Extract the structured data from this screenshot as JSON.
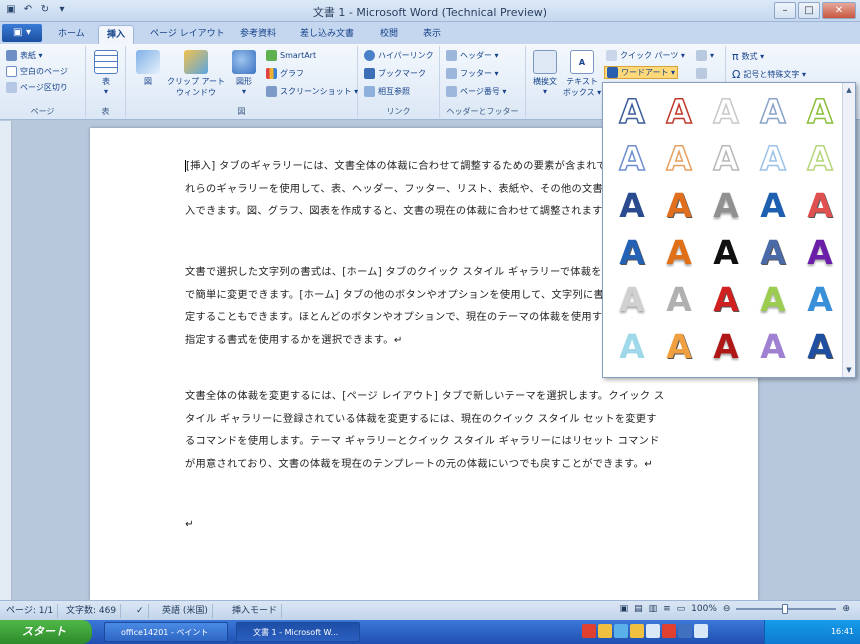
{
  "window": {
    "title": "文書 1 - Microsoft Word (Technical Preview)",
    "qat": [
      "save-icon",
      "undo-icon",
      "redo-icon"
    ]
  },
  "tabs": [
    "ホーム",
    "挿入",
    "ページ レイアウト",
    "参考資料",
    "差し込み文書",
    "校閲",
    "表示"
  ],
  "active_tab": "挿入",
  "ribbon": {
    "pages_group": {
      "label": "ページ",
      "items": [
        "表紙 ▾",
        "空白のページ",
        "ページ区切り"
      ]
    },
    "table_group": {
      "label": "表",
      "button": "表"
    },
    "illustrations_group": {
      "label": "図",
      "big": [
        "図",
        "クリップ アート",
        "図形"
      ],
      "clipart_sub": "ウィンドウ",
      "small": [
        "SmartArt",
        "グラフ",
        "スクリーンショット ▾"
      ]
    },
    "links_group": {
      "label": "リンク",
      "items": [
        "ハイパーリンク",
        "ブックマーク",
        "相互参照"
      ]
    },
    "headerfooter_group": {
      "label": "ヘッダーとフッター",
      "items": [
        "ヘッダー ▾",
        "フッター ▾",
        "ページ番号 ▾"
      ]
    },
    "text_group": {
      "big": [
        "横挨文",
        "テキスト"
      ],
      "textbox_sub": "ボックス ▾",
      "small": [
        "クイック パーツ ▾",
        "ワードアート ▾"
      ]
    },
    "symbols_group": {
      "items": [
        "数式 ▾",
        "記号と特殊文字 ▾"
      ]
    }
  },
  "document": {
    "paragraphs": [
      "[挿入] タブのギャラリーには、文書全体の体裁に合わせて調整するための要素が含まれています。これらのギャラリーを使用して、表、ヘッダー、フッター、リスト、表紙や、その他の文書パーツを挿入できます。図、グラフ、図表を作成すると、文書の現在の体裁に合わせて調整されます。↵",
      "文書で選択した文字列の書式は、[ホーム] タブのクイック スタイル ギャラリーで体裁を選択することで簡単に変更できます。[ホーム] タブの他のボタンやオプションを使用して、文字列に書式を直接設定することもできます。ほとんどのボタンやオプションで、現在のテーマの体裁を使用するか、直接指定する書式を使用するかを選択できます。↵",
      "文書全体の体裁を変更するには、[ページ レイアウト] タブで新しいテーマを選択します。クイック スタイル ギャラリーに登録されている体裁を変更するには、現在のクイック スタイル セットを変更するコマンドを使用します。テーマ ギャラリーとクイック スタイル ギャラリーにはリセット コマンドが用意されており、文書の体裁を現在のテンプレートの元の体裁にいつでも戻すことができます。↵",
      "↵"
    ]
  },
  "wordart_gallery": {
    "glyph": "A",
    "colors": [
      [
        "#3d5d9c",
        "#c0392b",
        "#c8c8c8",
        "#8aa2c8",
        "#8cbf3a"
      ],
      [
        "#6f8ed0",
        "#e8a060",
        "#b8b8b8",
        "#9cc2e8",
        "#b5d67a"
      ],
      [
        "#2a4c8f",
        "#e07020",
        "#909090",
        "#1f5fb0",
        "#e05050"
      ],
      [
        "#2462b5",
        "#e07018",
        "#111111",
        "#4a6aa8",
        "#6b1fa8"
      ],
      [
        "#d0d0d0",
        "#b0b0b0",
        "#d02020",
        "#9ccc50",
        "#3a90d8"
      ],
      [
        "#9fd8e8",
        "#f0a040",
        "#b01818",
        "#a080d0",
        "#1f4fa0"
      ]
    ]
  },
  "status": {
    "page": "ページ: 1/1",
    "words": "文字数: 469",
    "language": "英語 (米国)",
    "mode": "挿入モード",
    "zoom": "100%"
  },
  "taskbar": {
    "start": "スタート",
    "tasks": [
      "office14201 - ペイント",
      "文書 1 - Microsoft W..."
    ],
    "clock": "16:41"
  }
}
